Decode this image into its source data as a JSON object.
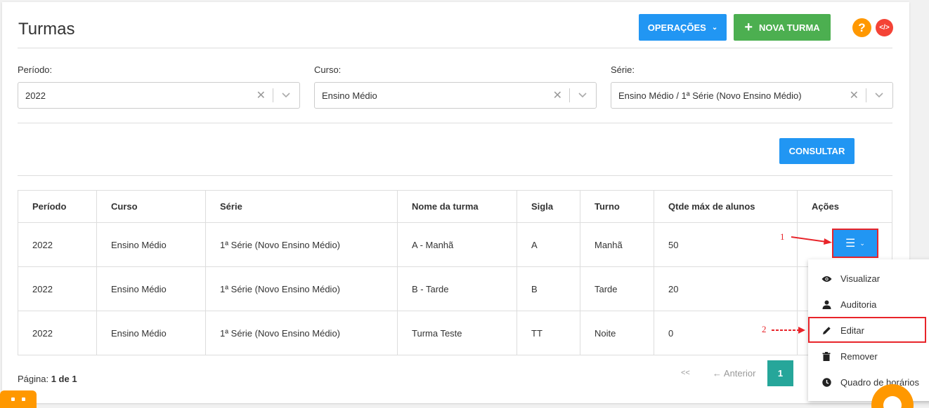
{
  "page": {
    "title": "Turmas"
  },
  "header": {
    "operations_label": "OPERAÇÕES",
    "new_label": "NOVA TURMA"
  },
  "filters": [
    {
      "label": "Período:",
      "value": "2022"
    },
    {
      "label": "Curso:",
      "value": "Ensino Médio"
    },
    {
      "label": "Série:",
      "value": "Ensino Médio / 1ª Série (Novo Ensino Médio)"
    }
  ],
  "consult_label": "CONSULTAR",
  "table": {
    "headers": [
      "Período",
      "Curso",
      "Série",
      "Nome da turma",
      "Sigla",
      "Turno",
      "Qtde máx de alunos",
      "Ações"
    ],
    "rows": [
      [
        "2022",
        "Ensino Médio",
        "1ª Série (Novo Ensino Médio)",
        "A - Manhã",
        "A",
        "Manhã",
        "50"
      ],
      [
        "2022",
        "Ensino Médio",
        "1ª Série (Novo Ensino Médio)",
        "B - Tarde",
        "B",
        "Tarde",
        "20"
      ],
      [
        "2022",
        "Ensino Médio",
        "1ª Série (Novo Ensino Médio)",
        "Turma Teste",
        "TT",
        "Noite",
        "0"
      ]
    ]
  },
  "actions_menu": [
    {
      "label": "Visualizar",
      "icon": "eye-icon"
    },
    {
      "label": "Auditoria",
      "icon": "user-icon"
    },
    {
      "label": "Editar",
      "icon": "pencil-icon"
    },
    {
      "label": "Remover",
      "icon": "trash-icon"
    },
    {
      "label": "Quadro de horários",
      "icon": "clock-icon"
    }
  ],
  "annotations": {
    "step1": "1",
    "step2": "2"
  },
  "pagination": {
    "label": "Página:",
    "value": "1 de 1",
    "first": "<<",
    "prev": "← Anterior",
    "current": "1"
  },
  "colors": {
    "primary": "#2196f3",
    "success": "#4caf50",
    "accent": "#ff9800",
    "danger": "#f44336",
    "annotation": "#e8242a",
    "page_active": "#26a69a"
  }
}
